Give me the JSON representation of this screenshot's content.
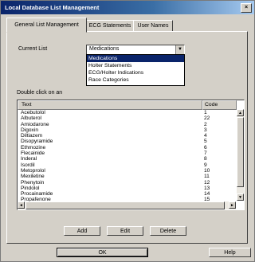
{
  "window": {
    "title": "Local Database List Management",
    "close_glyph": "×"
  },
  "tabs": [
    {
      "label": "General List Management"
    },
    {
      "label": "ECG Statements"
    },
    {
      "label": "User Names"
    }
  ],
  "current_list": {
    "label": "Current List",
    "value": "Medications",
    "options": [
      "Medications",
      "Holter Statements",
      "ECG/Holter Indications",
      "Race Categories"
    ]
  },
  "hint": "Double click on an",
  "table": {
    "columns": [
      "Text",
      "Code"
    ],
    "rows": [
      {
        "text": "Acebutolol",
        "code": "1"
      },
      {
        "text": "Albuterol",
        "code": "22"
      },
      {
        "text": "Amiodarone",
        "code": "2"
      },
      {
        "text": "Digoxin",
        "code": "3"
      },
      {
        "text": "Diltiazem",
        "code": "4"
      },
      {
        "text": "Disopyramide",
        "code": "5"
      },
      {
        "text": "Ethmozine",
        "code": "6"
      },
      {
        "text": "Flecainide",
        "code": "7"
      },
      {
        "text": "Inderal",
        "code": "8"
      },
      {
        "text": "Isordil",
        "code": "9"
      },
      {
        "text": "Metoprolol",
        "code": "10"
      },
      {
        "text": "Mexiletine",
        "code": "11"
      },
      {
        "text": "Phenytoin",
        "code": "12"
      },
      {
        "text": "Pindolol",
        "code": "13"
      },
      {
        "text": "Procainamide",
        "code": "14"
      },
      {
        "text": "Propafenone",
        "code": "15"
      }
    ]
  },
  "buttons": {
    "add": "Add",
    "edit": "Edit",
    "delete": "Delete",
    "ok": "OK",
    "help": "Help"
  },
  "scroll_glyphs": {
    "up": "▲",
    "down": "▼",
    "left": "◄",
    "right": "►",
    "combo": "▼"
  }
}
